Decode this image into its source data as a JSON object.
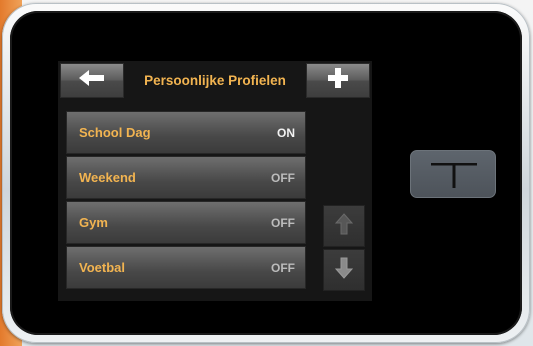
{
  "header": {
    "title": "Persoonlijke Profielen",
    "back_icon": "arrow-left-icon",
    "add_icon": "plus-icon"
  },
  "profiles": [
    {
      "name": "School Dag",
      "status": "ON"
    },
    {
      "name": "Weekend",
      "status": "OFF"
    },
    {
      "name": "Gym",
      "status": "OFF"
    },
    {
      "name": "Voetbal",
      "status": "OFF"
    }
  ],
  "scroll": {
    "up_icon": "arrow-up-icon",
    "down_icon": "arrow-down-icon"
  },
  "device": {
    "home_button_icon": "t-logo-icon"
  },
  "colors": {
    "title": "#f2b451",
    "profile_name": "#f2b451",
    "status_on": "#f2f2f2",
    "status_off": "#bcbcbc",
    "screen_background": "#161616",
    "accent": "#e37a2c"
  }
}
